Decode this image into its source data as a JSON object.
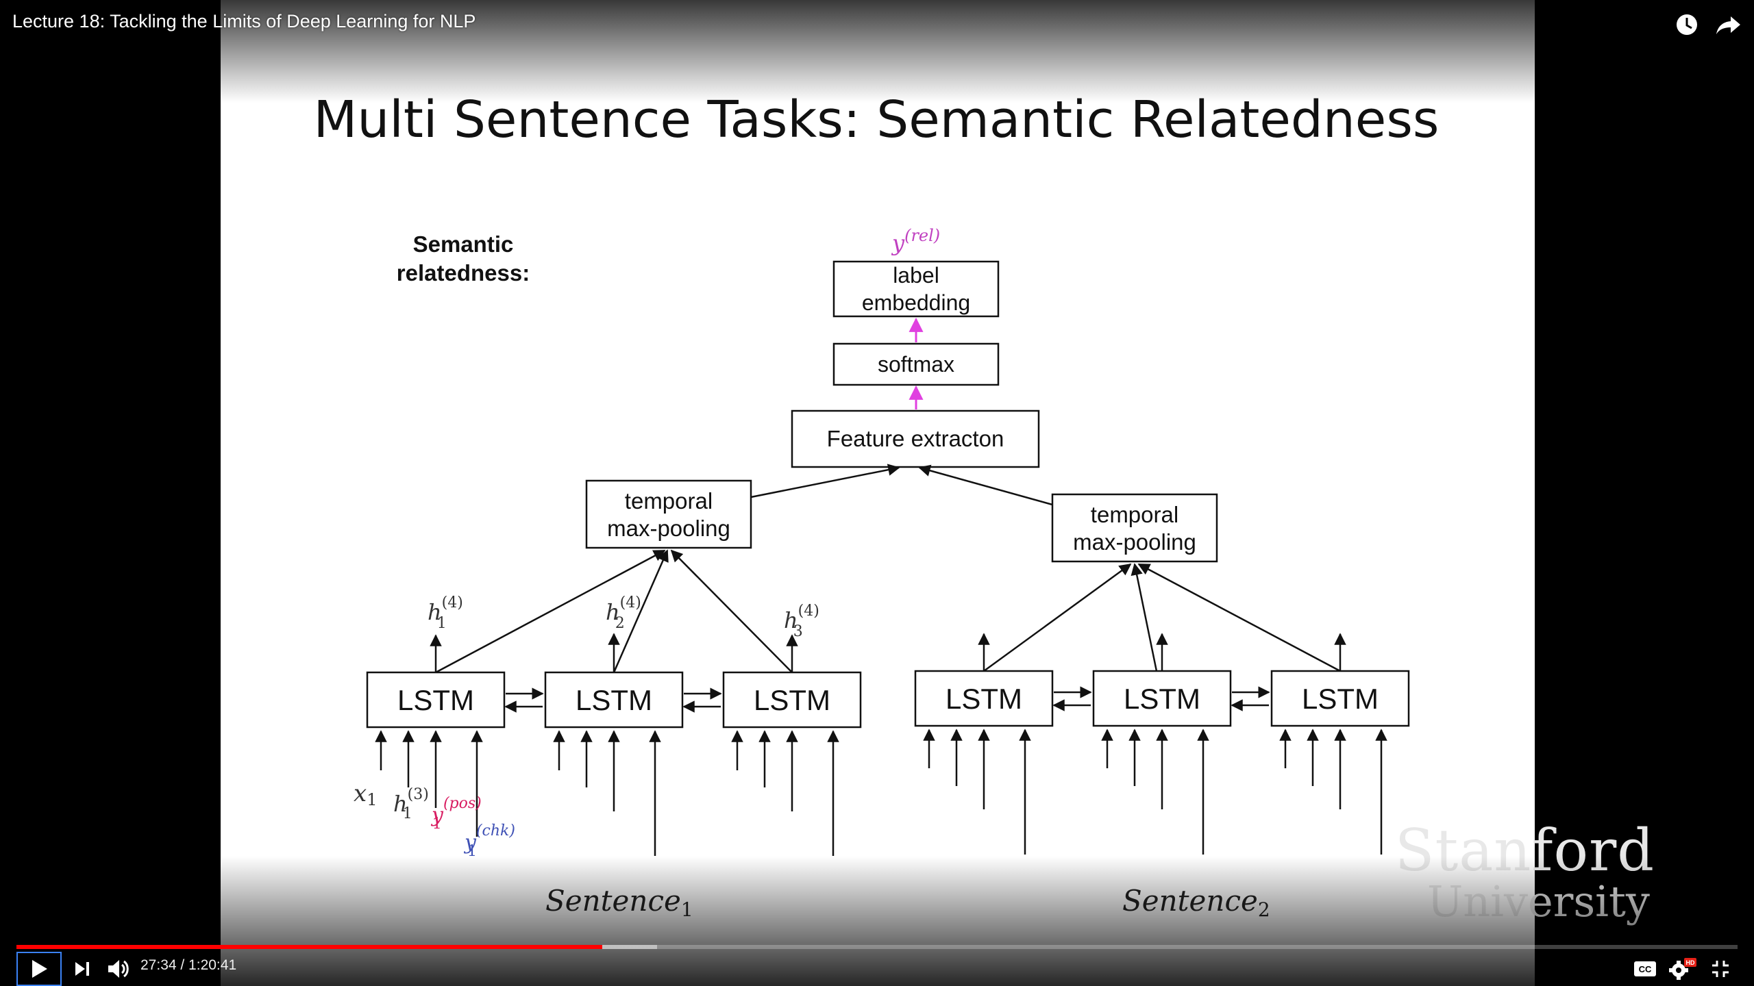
{
  "video": {
    "title": "Lecture 18: Tackling the Limits of Deep Learning for NLP"
  },
  "slide": {
    "title": "Multi Sentence Tasks: Semantic Relatedness",
    "side_label_line1": "Semantic",
    "side_label_line2": "relatedness:",
    "output_label": "y",
    "output_sup": "(rel)",
    "box_label_embedding_line1": "label",
    "box_label_embedding_line2": "embedding",
    "box_softmax": "softmax",
    "box_feature": "Feature extracton",
    "box_pool_line1": "temporal",
    "box_pool_line2": "max-pooling",
    "box_lstm": "LSTM",
    "h_label": "h",
    "h_sup": "(4)",
    "h_subs": [
      "1",
      "2",
      "3"
    ],
    "x_label": "x",
    "x_sub": "1",
    "h3_label": "h",
    "h3_sup": "(3)",
    "h3_sub": "1",
    "ypos_label": "y",
    "ypos_sup": "(pos)",
    "ypos_sub": "1",
    "ychk_label": "y",
    "ychk_sup": "(chk)",
    "ychk_sub": "1",
    "sentence_label": "Sentence",
    "sentence1_sub": "1",
    "sentence2_sub": "2",
    "logo_line1": "Stanford",
    "logo_line2": "University"
  },
  "controls": {
    "time_display": "27:34 / 1:20:41",
    "played_fraction": 0.3403,
    "loaded_fraction": 0.3722,
    "icons": [
      "play-icon",
      "next-icon",
      "volume-icon",
      "watch-later-icon",
      "share-icon",
      "captions-icon",
      "settings-icon",
      "hd-badge",
      "exit-fullscreen-icon"
    ],
    "hd_badge": "HD",
    "cc_label": "CC"
  },
  "colors": {
    "progress_played": "#ff0000",
    "magenta_arrow": "#e040e0",
    "ypos_color": "#d81b60",
    "ychk_color": "#3f51b5",
    "output_label_color": "#c040c0"
  }
}
